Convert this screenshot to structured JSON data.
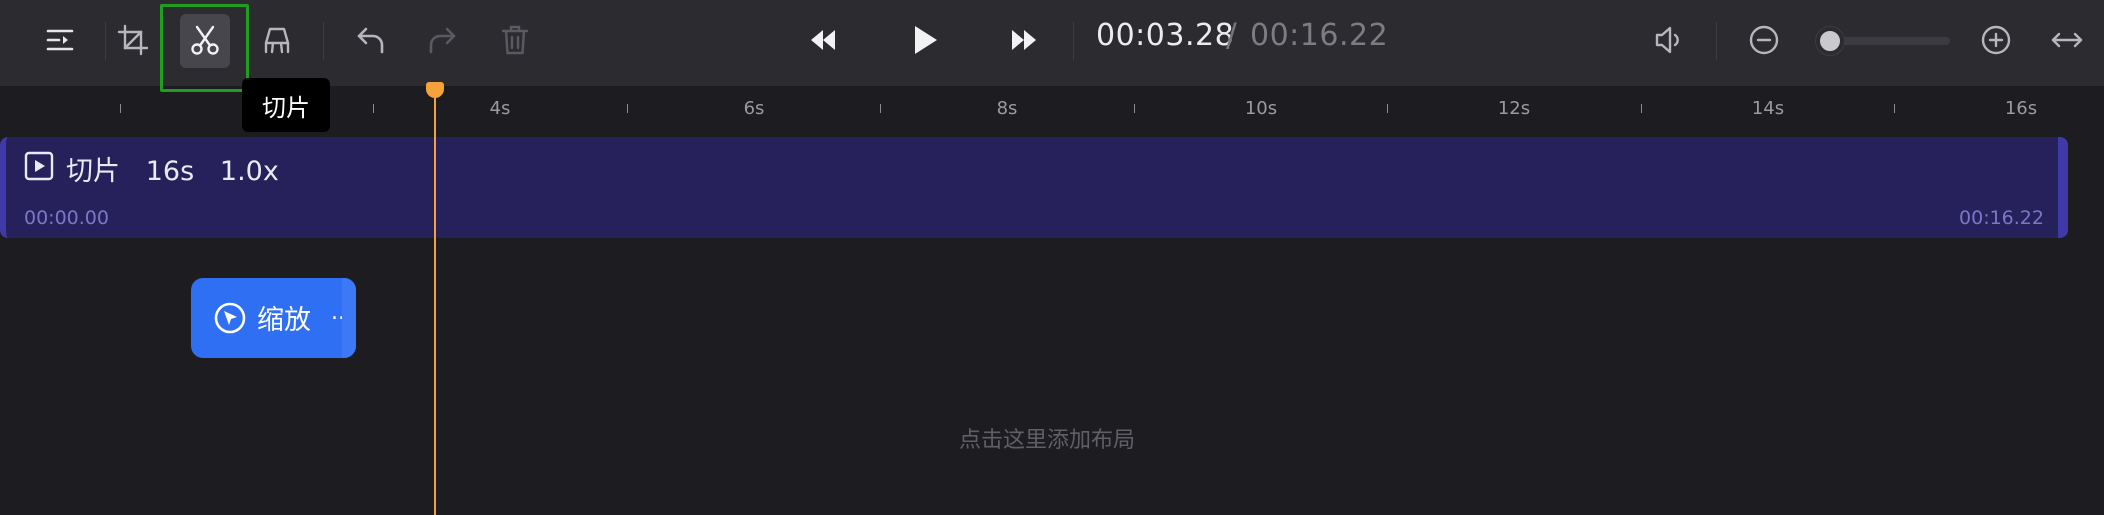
{
  "toolbar": {
    "buttons": {
      "collapse": {
        "icon": "indent-icon"
      },
      "crop": {
        "icon": "crop-icon"
      },
      "cut": {
        "icon": "scissors-icon",
        "selected": true
      },
      "layout": {
        "icon": "layout-icon"
      },
      "undo": {
        "icon": "undo-icon"
      },
      "redo": {
        "icon": "redo-icon",
        "disabled": true
      },
      "delete": {
        "icon": "trash-icon",
        "disabled": true
      },
      "rewind": {
        "icon": "rewind-icon"
      },
      "play": {
        "icon": "play-icon"
      },
      "forward": {
        "icon": "fast-forward-icon"
      },
      "volume": {
        "icon": "volume-icon"
      },
      "zoom_out": {
        "icon": "zoom-out-icon"
      },
      "zoom_in": {
        "icon": "zoom-in-icon"
      },
      "fit": {
        "icon": "fit-width-icon"
      }
    },
    "current_time": "00:03.28",
    "separator": "/",
    "total_time": "00:16.22",
    "zoom_level": 0.06
  },
  "tooltip": {
    "text": "切片"
  },
  "ruler": {
    "labels": [
      "4s",
      "6s",
      "8s",
      "10s",
      "12s",
      "14s",
      "16s"
    ]
  },
  "clip": {
    "title": "切片   16s   1.0x",
    "start_time": "00:00.00",
    "end_time": "00:16.22",
    "icon": "play-square-icon"
  },
  "zoom_block": {
    "label": "缩放",
    "more": "..",
    "icon": "cursor-circle-icon"
  },
  "hint": {
    "text": "点击这里添加布局"
  },
  "colors": {
    "accent": "#2f6ff4",
    "playhead": "#f4a23a",
    "clip_bg": "#27215b",
    "selection_border": "#1f9e1f"
  }
}
